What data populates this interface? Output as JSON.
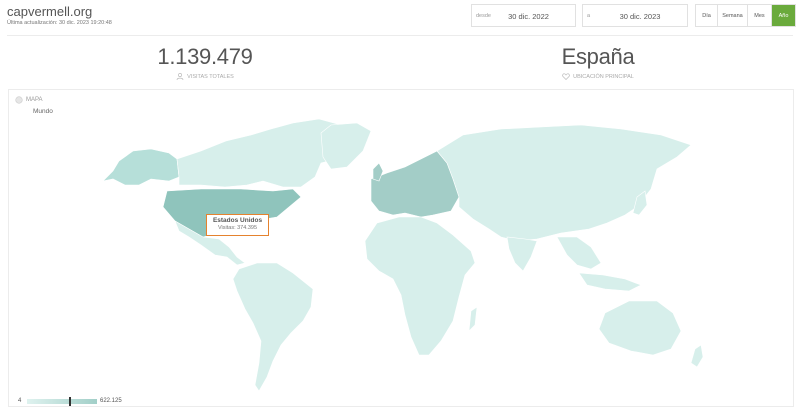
{
  "header": {
    "site": "capvermell.org",
    "last_update": "Última actualización: 30 dic. 2023 19:20:48"
  },
  "date_range": {
    "from_label": "desde",
    "from_value": "30 dic. 2022",
    "to_label": "a",
    "to_value": "30 dic. 2023"
  },
  "periods": {
    "day": "Día",
    "week": "Semana",
    "month": "Mes",
    "year": "Año",
    "selected": "Año"
  },
  "stats": {
    "total_visits": "1.139.479",
    "total_visits_label": "Visitas totales",
    "main_location": "España",
    "main_location_label": "Ubicación principal"
  },
  "map": {
    "header_label": "MAPA",
    "region": "Mundo",
    "tooltip": {
      "country": "Estados Unidos",
      "visits": "Visitas: 374.395"
    },
    "legend": {
      "min": "4",
      "max": "622.125",
      "marker_fraction": 0.6
    },
    "colors": {
      "default_land": "#d7efeb",
      "medium": "#b6dfd9",
      "europe": "#a3cdc7",
      "usa": "#8fc4bc",
      "accent_green": "#6aaa3c",
      "tooltip_border": "#e5822e"
    }
  }
}
